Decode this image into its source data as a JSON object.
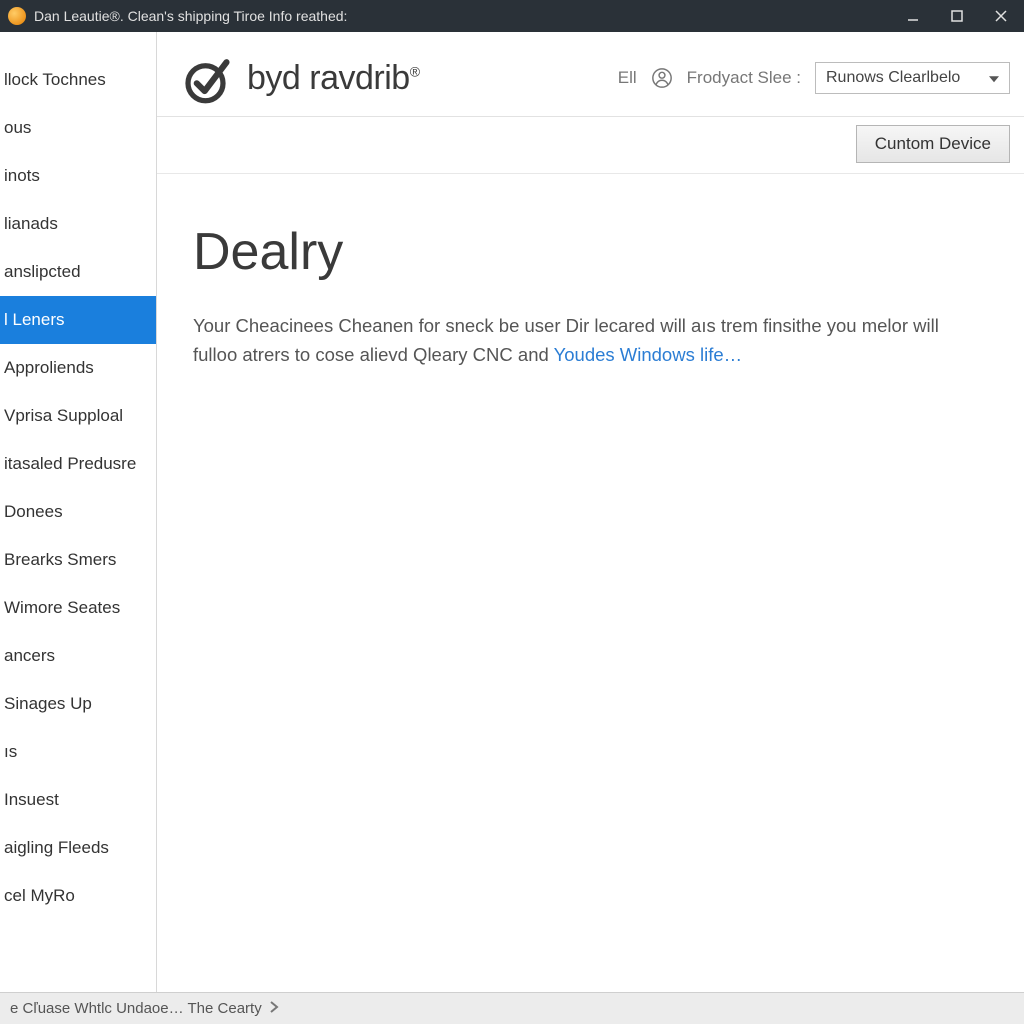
{
  "window": {
    "title": "Dan Leautie®. Clean's shipping Tiroe Info reathed:"
  },
  "sidebar": {
    "items": [
      {
        "label": "llock Tochnes",
        "active": false
      },
      {
        "label": "ous",
        "active": false
      },
      {
        "label": "inots",
        "active": false
      },
      {
        "label": "lianads",
        "active": false
      },
      {
        "label": "anslipcted",
        "active": false
      },
      {
        "label": "l Leners",
        "active": true
      },
      {
        "label": "Approliends",
        "active": false
      },
      {
        "label": "Vprisa Supploal",
        "active": false
      },
      {
        "label": "itasaled Predusre",
        "active": false
      },
      {
        "label": "Donees",
        "active": false
      },
      {
        "label": "Brearks Smers",
        "active": false
      },
      {
        "label": "Wimore Seates",
        "active": false
      },
      {
        "label": "ancers",
        "active": false
      },
      {
        "label": "Sinages Up",
        "active": false
      },
      {
        "label": "ıs",
        "active": false
      },
      {
        "label": "Insuest",
        "active": false
      },
      {
        "label": "aigling Fleeds",
        "active": false
      },
      {
        "label": "cel MyRo",
        "active": false
      }
    ]
  },
  "header": {
    "logo_text": "byd ravdrib",
    "logo_suffix": "®",
    "link_ell": "Ell",
    "select_label": "Frodyact Slee :",
    "select_value": "Runows Clearlbelo",
    "custom_button": "Cuntom Device"
  },
  "content": {
    "heading": "Dealry",
    "paragraph_pre": "Your Cheacinees Cheanen for sneck be user Dir lecared will aıs trem finsithe you melor will fulloo atrers to cose alievd Qleary CNC and ",
    "link_text": "Youdes Windows life…"
  },
  "statusbar": {
    "text": "e Cľuase Whtlc Undaoe… The Cearty",
    "chevron": "›"
  }
}
